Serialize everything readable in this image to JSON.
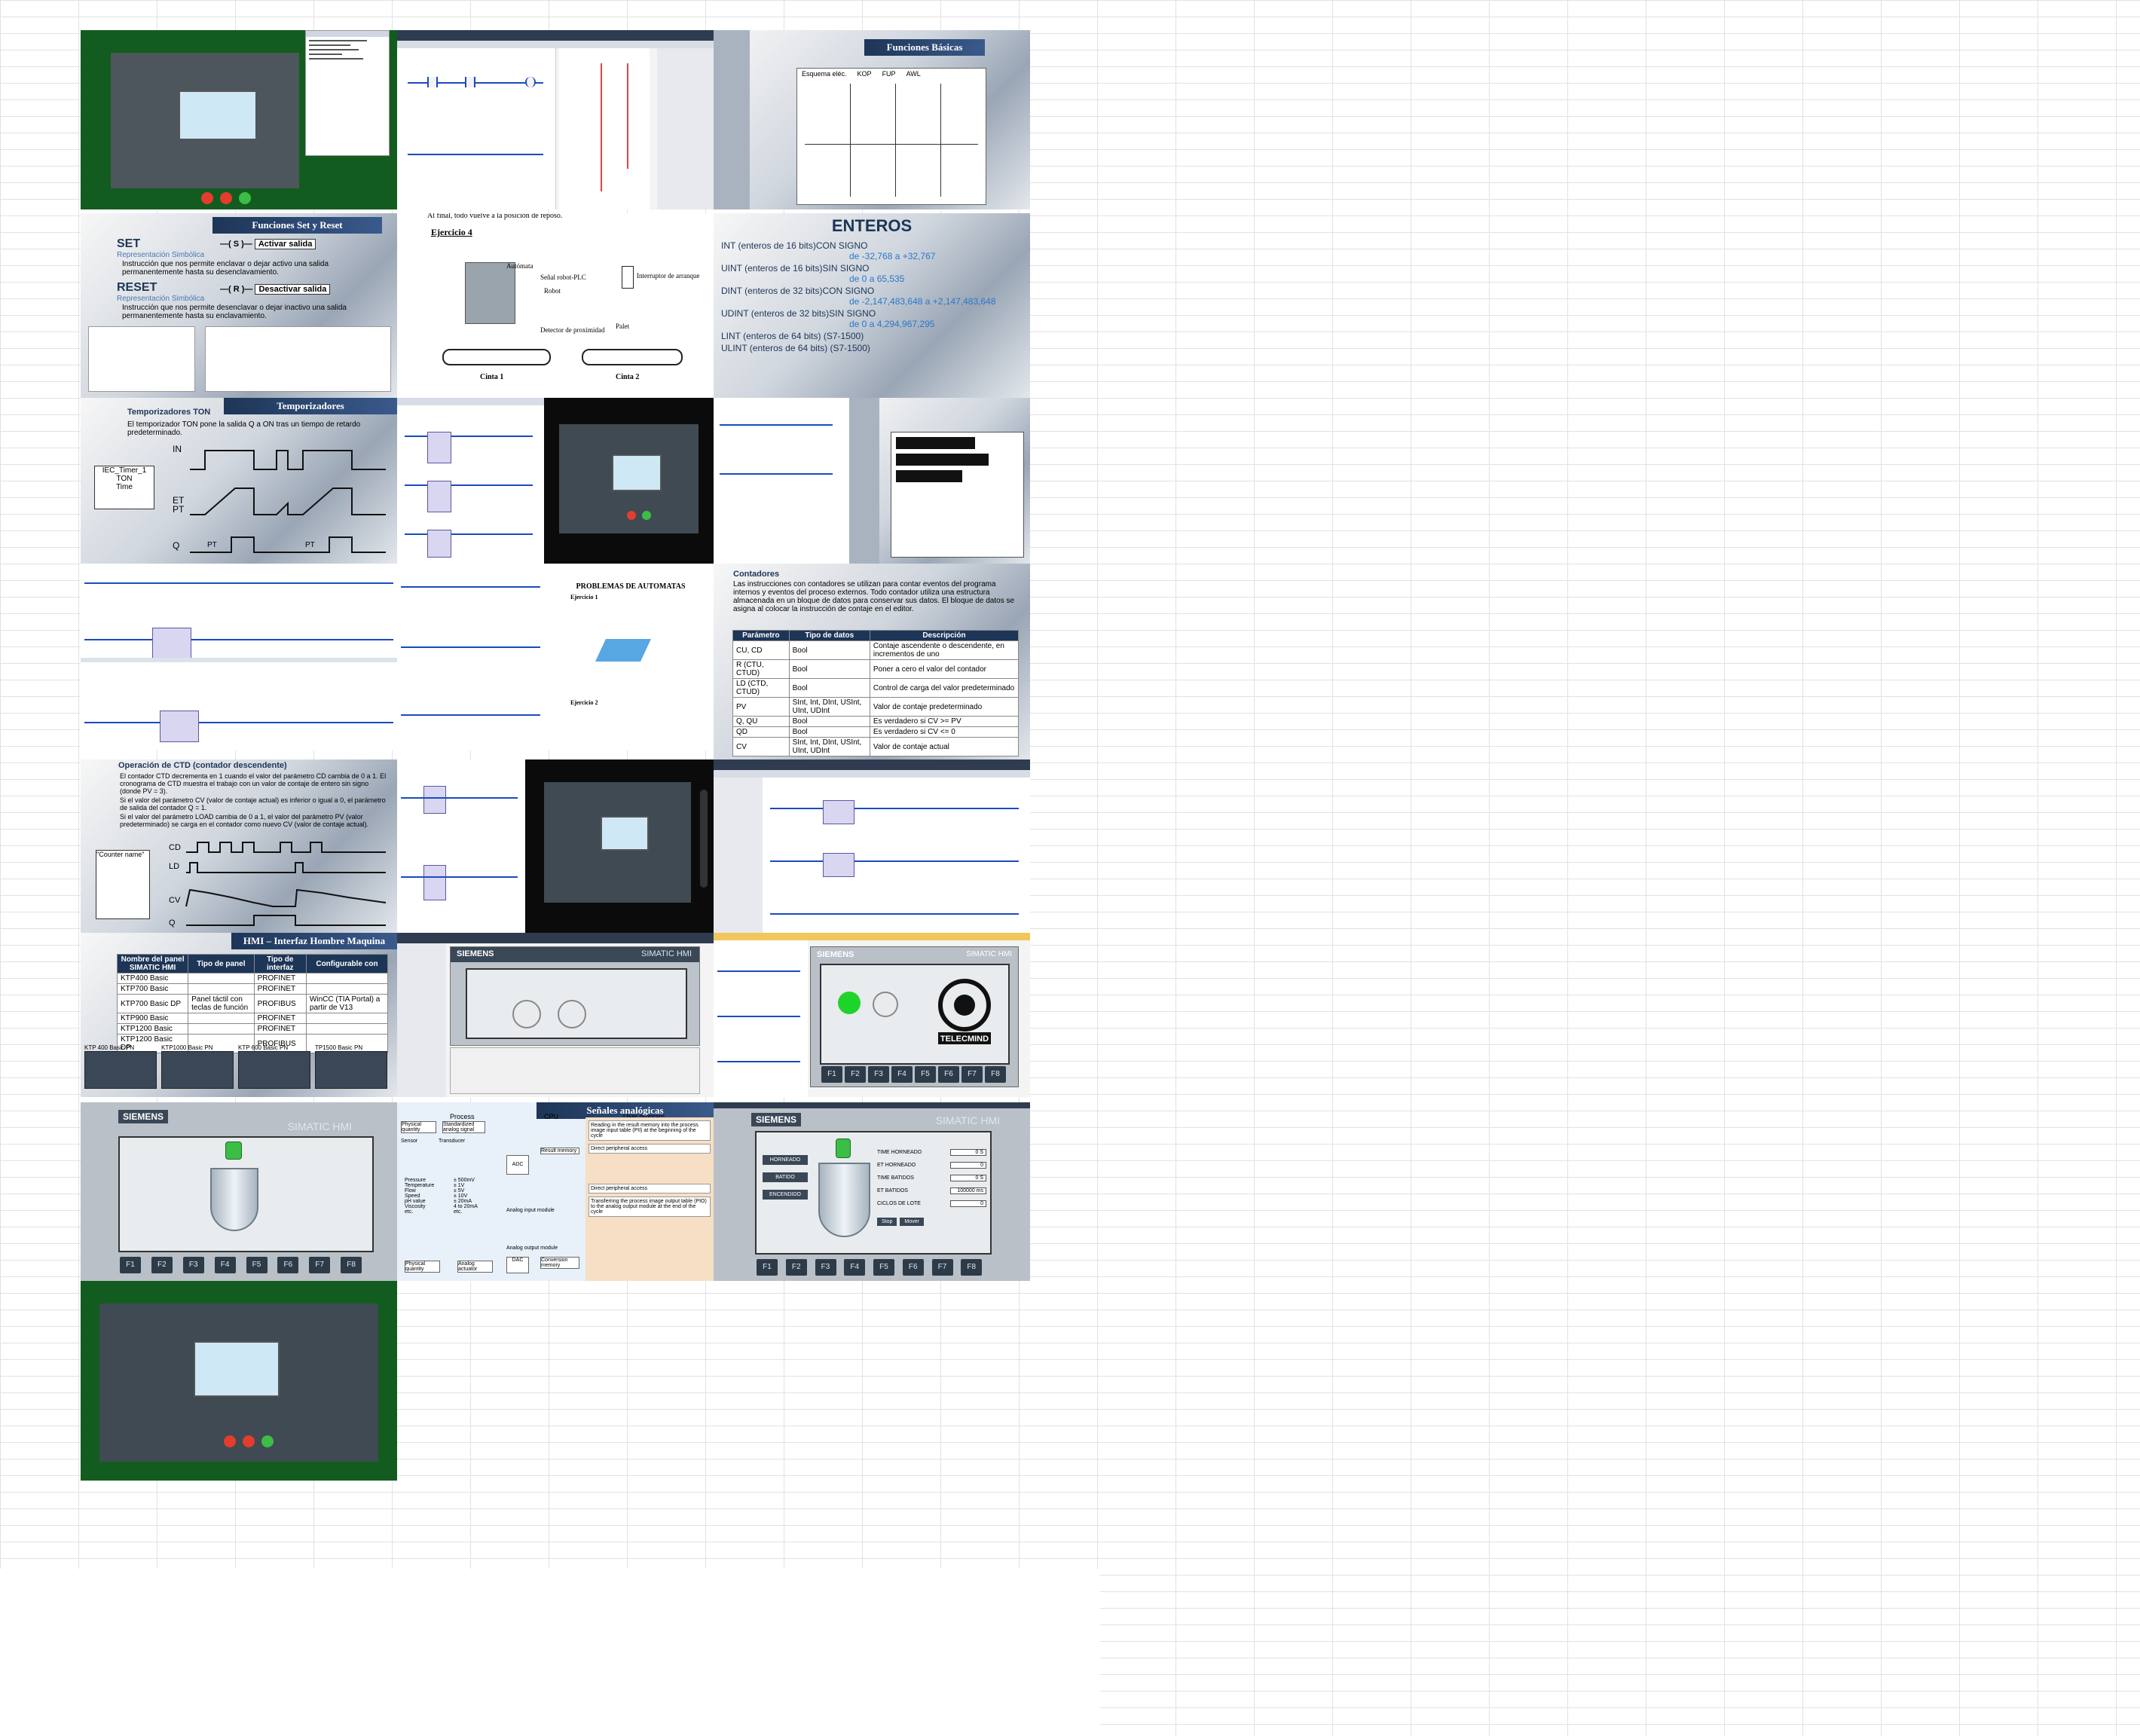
{
  "tiles": {
    "funciones_basicas": {
      "title": "Funciones Básicas",
      "labels": [
        "Esquema eléc.",
        "KOP",
        "FUP",
        "AWL"
      ]
    },
    "set_reset": {
      "title": "Funciones Set y Reset",
      "set_label": "SET",
      "set_sub": "Representación Simbólica",
      "set_desc": "Instrucción que nos permite enclavar o dejar activo una salida permanentemente hasta su desenclavamiento.",
      "set_btn": "Activar salida",
      "reset_label": "RESET",
      "reset_sub": "Representación Simbólica",
      "reset_desc": "Instrucción que nos permite desenclavar o dejar inactivo una salida permanentemente hasta su enclavamiento.",
      "reset_btn": "Desactivar salida"
    },
    "ejercicio": {
      "top_line": "Al final, todo vuelve a la posición de reposo.",
      "heading": "Ejercicio 4",
      "labels": [
        "Autómata",
        "Señal robot-PLC",
        "Robot",
        "Interruptor de arranque",
        "Detector de proximidad",
        "Palet",
        "Cinta 1",
        "Cinta 2"
      ]
    },
    "enteros": {
      "title": "ENTEROS",
      "lines": [
        {
          "t": "INT (enteros de 16 bits)CON SIGNO",
          "v": "de -32,768 a +32,767"
        },
        {
          "t": "UINT (enteros de 16 bits)SIN SIGNO",
          "v": "de 0 a 65,535"
        },
        {
          "t": "DINT (enteros de 32 bits)CON SIGNO",
          "v": "de -2,147,483,648 a +2,147,483,648"
        },
        {
          "t": "UDINT (enteros de 32 bits)SIN SIGNO",
          "v": "de 0 a 4,294,967,295"
        },
        {
          "t": "LINT (enteros de 64 bits) (S7-1500)",
          "v": ""
        },
        {
          "t": "ULINT (enteros de 64 bits) (S7-1500)",
          "v": ""
        }
      ]
    },
    "temporizadores": {
      "title": "Temporizadores",
      "subtitle": "Temporizadores TON",
      "desc": "El temporizador TON pone la salida Q a ON tras un tiempo de retardo predeterminado.",
      "block_name": "IEC_Timer_1",
      "block_lines": [
        "TON",
        "Time"
      ],
      "signals": [
        "IN",
        "ET",
        "PT",
        "Q"
      ],
      "pt_marks": [
        "PT",
        "PT"
      ]
    },
    "problemas": {
      "title": "PROBLEMAS DE AUTOMATAS",
      "sub": "Ejercicio 1",
      "sub2": "Ejercicio 2"
    },
    "contadores": {
      "title": "Contadores",
      "desc": "Las instrucciones con contadores se utilizan para contar eventos del programa internos y eventos del proceso externos. Todo contador utiliza una estructura almacenada en un bloque de datos para conservar sus datos. El bloque de datos se asigna al colocar la instrucción de contaje en el editor.",
      "headers": [
        "Parámetro",
        "Tipo de datos",
        "Descripción"
      ],
      "rows": [
        [
          "CU, CD",
          "Bool",
          "Contaje ascendente o descendente, en incrementos de uno"
        ],
        [
          "R (CTU, CTUD)",
          "Bool",
          "Poner a cero el valor del contador"
        ],
        [
          "LD (CTD, CTUD)",
          "Bool",
          "Control de carga del valor predeterminado"
        ],
        [
          "PV",
          "SInt, Int, DInt, USInt, UInt, UDInt",
          "Valor de contaje predeterminado"
        ],
        [
          "Q, QU",
          "Bool",
          "Es verdadero si CV >= PV"
        ],
        [
          "QD",
          "Bool",
          "Es verdadero si CV <= 0"
        ],
        [
          "CV",
          "SInt, Int, DInt, USInt, UInt, UDInt",
          "Valor de contaje actual"
        ]
      ]
    },
    "ctd": {
      "title": "Operación de CTD (contador descendente)",
      "bullets": [
        "El contador CTD decrementa en 1 cuando el valor del parámetro CD cambia de 0 a 1. El cronograma de CTD muestra el trabajo con un valor de contaje de entero sin signo (donde PV = 3).",
        "Si el valor del parámetro CV (valor de contaje actual) es inferior o igual a 0, el parámetro de salida del contador Q = 1.",
        "Si el valor del parámetro LOAD cambia de 0 a 1, el valor del parámetro PV (valor predeterminado) se carga en el contador como nuevo CV (valor de contaje actual)."
      ],
      "block_name": "\"Counter name\"",
      "signals": [
        "CD",
        "LD",
        "CV",
        "Q"
      ]
    },
    "hmi_table": {
      "title": "HMI – Interfaz Hombre Maquina",
      "headers": [
        "Nombre del panel SIMATIC HMI",
        "Tipo de panel",
        "Tipo de interfaz",
        "Configurable con"
      ],
      "rows": [
        [
          "KTP400 Basic",
          "",
          "PROFINET",
          ""
        ],
        [
          "KTP700 Basic",
          "",
          "PROFINET",
          ""
        ],
        [
          "KTP700 Basic DP",
          "Panel táctil con teclas de función",
          "PROFIBUS",
          "WinCC (TIA Portal) a partir de V13"
        ],
        [
          "KTP900 Basic",
          "",
          "PROFINET",
          ""
        ],
        [
          "KTP1200 Basic",
          "",
          "PROFINET",
          ""
        ],
        [
          "KTP1200 Basic DP",
          "",
          "PROFIBUS",
          ""
        ]
      ],
      "thumbs": [
        "KTP 400 Basic PN",
        "KTP1000 Basic PN",
        "KTP 600 Basic PN",
        "TP1500 Basic PN"
      ]
    },
    "hmi_generic": {
      "brand": "SIEMENS",
      "product": "SIMATIC HMI",
      "fkeys": [
        "F1",
        "F2",
        "F3",
        "F4",
        "F5",
        "F6",
        "F7",
        "F8"
      ]
    },
    "telecmind": {
      "name": "TELECMIND"
    },
    "analogicas": {
      "title": "Señales analógicas",
      "col1": "Process",
      "col2": "CPU",
      "col3": "User program",
      "boxes": [
        "Physical quantity",
        "Standardized analog signal",
        "Sensor",
        "Transducer",
        "ADC",
        "Result memory",
        "DAC",
        "Conversion memory",
        "Physical quantity",
        "Analog actuator"
      ],
      "list": [
        "Pressure",
        "Temperature",
        "Flow",
        "Speed",
        "pH value",
        "Viscosity",
        "etc."
      ],
      "list2": [
        "± 500mV",
        "± 1V",
        "± 5V",
        "± 10V",
        "± 20mA",
        "4 to 20mA",
        "etc."
      ],
      "notes": [
        "Reading in the result memory into the process image input table (PII) at the beginning of the cycle",
        "Direct peripheral access",
        "Direct peripheral access",
        "Transferring the process image output table (PIO) to the analog output module at the end of the cycle"
      ],
      "module_in": "Analog input module",
      "module_out": "Analog output module"
    },
    "hmi_values": {
      "labels": [
        "TIME HORNEADO",
        "ET HORNEADO",
        "TIME BATIDOS",
        "ET BATIDOS",
        "CICLOS DE LOTE"
      ],
      "values": [
        "0 S",
        "0",
        "0 S",
        "100000 ms",
        "0"
      ],
      "buttons": [
        "HORNEADO",
        "BATIDO",
        "ENCENDIDO"
      ],
      "right_btn": [
        "Stop",
        "Mover"
      ]
    }
  },
  "colors": {
    "accent": "#1d3557",
    "ladder": "#1a4bbf",
    "green": "#3cbd45",
    "siemens": "#00969d"
  }
}
